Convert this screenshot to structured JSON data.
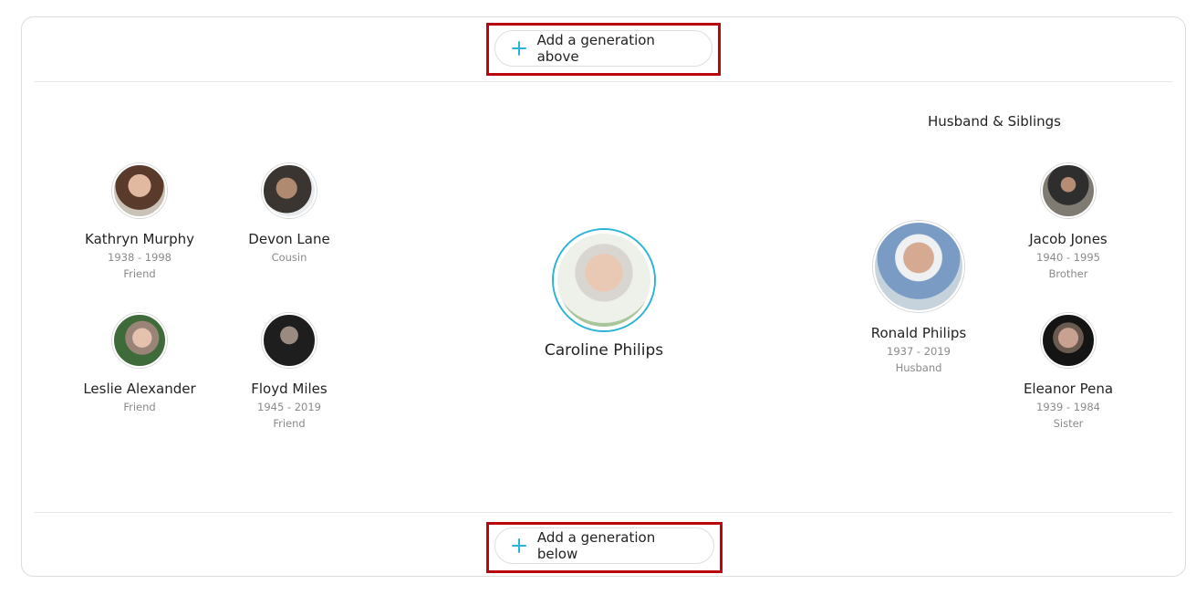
{
  "top_button": {
    "label": "Add a generation above"
  },
  "bottom_button": {
    "label": "Add a generation below"
  },
  "right_section": {
    "title": "Husband & Siblings"
  },
  "main_person": {
    "name": "Caroline Philips"
  },
  "people": {
    "kathryn": {
      "name": "Kathryn Murphy",
      "years": "1938 - 1998",
      "relation": "Friend"
    },
    "devon": {
      "name": "Devon Lane",
      "relation": "Cousin"
    },
    "leslie": {
      "name": "Leslie Alexander",
      "relation": "Friend"
    },
    "floyd": {
      "name": "Floyd Miles",
      "years": "1945 - 2019",
      "relation": "Friend"
    },
    "ronald": {
      "name": "Ronald Philips",
      "years": "1937 - 2019",
      "relation": "Husband"
    },
    "jacob": {
      "name": "Jacob Jones",
      "years": "1940 - 1995",
      "relation": "Brother"
    },
    "eleanor": {
      "name": "Eleanor Pena",
      "years": "1939 - 1984",
      "relation": "Sister"
    }
  },
  "colors": {
    "accent": "#2ab3d6",
    "highlight": "#b8070e"
  },
  "icons": {
    "add": "plus-icon"
  }
}
